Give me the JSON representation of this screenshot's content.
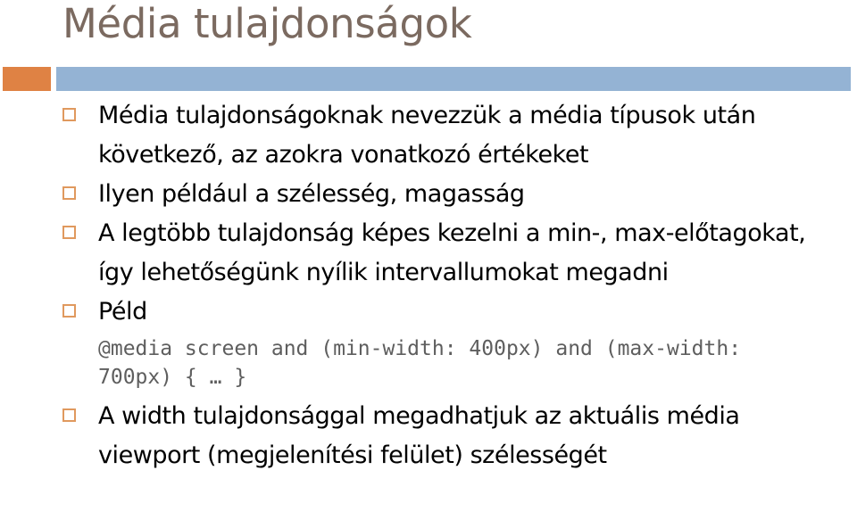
{
  "slide": {
    "title": "Média tulajdonságok",
    "colors": {
      "title": "#7B6A60",
      "accent_block": "#DF8244",
      "accent_bar": "#94B3D4",
      "bullet_marker": "#E0995E",
      "body_text": "#000000",
      "code_text": "#5E5E5E",
      "background": "#FFFFFF"
    },
    "divider": {
      "block_name": "orange-accent-block",
      "bar_name": "blue-accent-bar"
    },
    "bullets": [
      {
        "marker": "hollow-square-bullet",
        "text": "Média tulajdonságoknak nevezzük a média típusok után következő, az azokra vonatkozó értékeket"
      },
      {
        "marker": "hollow-square-bullet",
        "text": "Ilyen például a szélesség, magasság"
      },
      {
        "marker": "hollow-square-bullet",
        "text": "A legtöbb tulajdonság képes kezelni a min-, max-előtagokat, így lehetőségünk nyílik intervallumokat megadni"
      },
      {
        "marker": "hollow-square-bullet",
        "text": "Péld"
      }
    ],
    "code_example": "@media screen and (min-width: 400px) and (max-width: 700px) { … }",
    "final_bullet": {
      "marker": "hollow-square-bullet",
      "text": "A width tulajdonsággal megadhatjuk az aktuális média viewport (megjelenítési felület) szélességét"
    }
  }
}
